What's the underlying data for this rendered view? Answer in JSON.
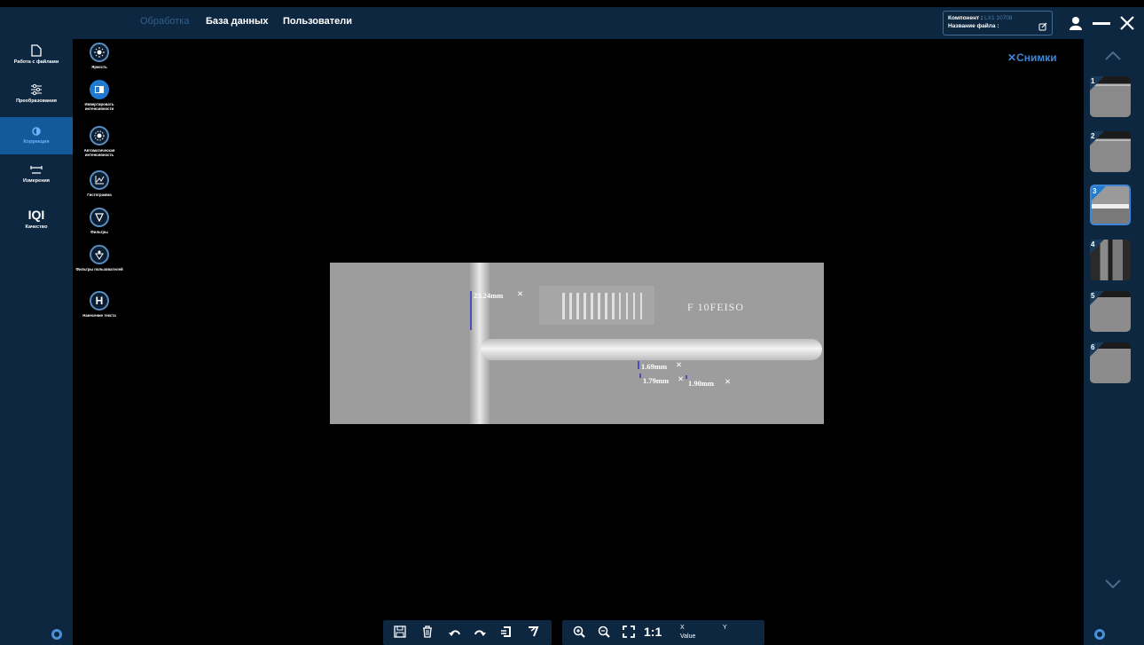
{
  "topnav": {
    "tab1": "Обработка",
    "tab2": "База данных",
    "tab3": "Пользователи"
  },
  "info": {
    "component_label": "Компонент :",
    "component_value": "LX1 10708",
    "filename_label": "Название файла :"
  },
  "sidebar": [
    {
      "label": "Работа с файлами",
      "icon": "file-icon"
    },
    {
      "label": "Преобразования",
      "icon": "sliders-icon"
    },
    {
      "label": "Коррекция",
      "icon": "brightness-icon"
    },
    {
      "label": "Измерения",
      "icon": "measure-icon"
    },
    {
      "label": "Качество",
      "icon": "iqi-icon",
      "glyph": "IQI"
    }
  ],
  "tools": [
    {
      "label": "Яркость",
      "icon": "sun-icon"
    },
    {
      "label": "Инвертировать интенсивности",
      "icon": "invert-icon"
    },
    {
      "label": "Автоматическая интенсивность",
      "icon": "auto-intensity-icon"
    },
    {
      "label": "Гистограмма",
      "icon": "histogram-icon"
    },
    {
      "label": "Фильтры",
      "icon": "filter-icon"
    },
    {
      "label": "Фильтры пользователей",
      "icon": "user-filter-icon"
    },
    {
      "label": "Нанесение текста",
      "icon": "text-icon",
      "glyph": "H"
    }
  ],
  "snapshots": {
    "close_label": "Снимки",
    "items": [
      "1",
      "2",
      "3",
      "4",
      "5",
      "6"
    ],
    "selected": "3"
  },
  "image": {
    "marker_text": "F 10FEISO",
    "measurements": [
      "23.24mm",
      "1.69mm",
      "1.79mm",
      "1.90mm"
    ]
  },
  "toolbar": {
    "ratio": "1:1",
    "x_label": "X",
    "value_label": "Value",
    "y_label": "Y"
  },
  "colors": {
    "panel": "#0e2740",
    "accent": "#1f7ad0",
    "link": "#3f86d6"
  }
}
